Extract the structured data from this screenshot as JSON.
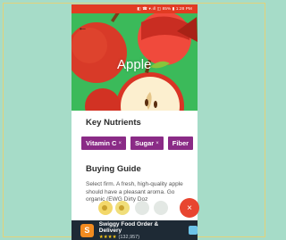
{
  "status_bar": {
    "text": "◧ ☎ ▾.ıll ◫ 85% ▮ 1:28 PM"
  },
  "hero": {
    "title": "Apple",
    "back_icon": "back-arrow-icon",
    "bg_color": "#3bba5a"
  },
  "nutrients": {
    "title": "Key Nutrients",
    "chips": [
      {
        "label": "Vitamin C"
      },
      {
        "label": "Sugar"
      },
      {
        "label": "Fiber"
      }
    ],
    "chip_color": "#8a2b86"
  },
  "buying_guide": {
    "title": "Buying Guide",
    "text": "Select firm. A fresh, high-quality apple should have a pleasant aroma. Go organic (EWG Dirty Doz"
  },
  "fab_menu": {
    "items": [
      "star-icon",
      "star-icon",
      "circle-icon",
      "circle-icon"
    ],
    "close_icon": "close-icon",
    "close_color": "#e8452f"
  },
  "ad": {
    "title": "Swiggy Food Order & Delivery",
    "rating": "★★★★",
    "count": "(132,957)",
    "icon_letter": "S"
  }
}
